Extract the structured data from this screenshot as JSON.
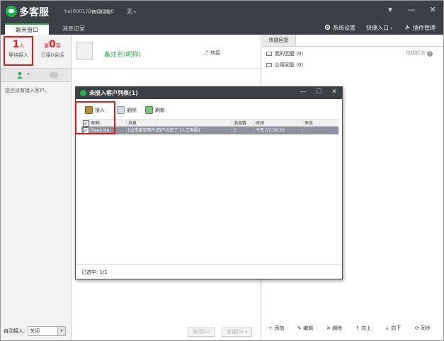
{
  "titlebar": {
    "app_title": "多客服",
    "account": "hu[0001]@webusc0",
    "status": "自动回复",
    "status_value": "无",
    "controls": [
      "▾",
      "—",
      "✕"
    ]
  },
  "nav": {
    "tabs": [
      "聊天窗口",
      "消息记录"
    ],
    "active_tab": 0,
    "right": [
      "系统设置",
      "快捷入口",
      "插件管理"
    ]
  },
  "left": {
    "waiting": {
      "num": "1",
      "unit": "人",
      "label": "等待接入"
    },
    "sessions": {
      "num": "0",
      "unit": "客",
      "label": "已接0会话",
      "prefix": "第"
    },
    "empty_text": "您还没有接入客户。",
    "auto_accept_label": "自动接入:",
    "auto_accept_value": "关闭"
  },
  "middle": {
    "remark_name": "备注名(昵称)",
    "transfer": "转接",
    "close_btn": "关闭(C)",
    "send_btn": "发送(S)"
  },
  "right": {
    "tab": "快捷回复",
    "tip": "快捷标志",
    "folders": [
      "我的回复 (0)",
      "公用回复 (0)"
    ],
    "actions": [
      "添加",
      "编辑",
      "删除",
      "向上",
      "向下",
      "同步"
    ]
  },
  "dialog": {
    "title": "未接入客户列表(1)",
    "toolbar": [
      "接入",
      "删除",
      "刷新"
    ],
    "columns": [
      "昵称",
      "消息",
      "消息数",
      "时间",
      "来自"
    ],
    "rows": [
      {
        "nickname": "Raen Hu",
        "message": "[点击菜单事件]用户点击了 [人工客服]",
        "count": "1",
        "time": "今天 07:58:33",
        "from": ""
      }
    ],
    "selected": "已选中: 1/1"
  },
  "colors": {
    "accent_green": "#23b14d",
    "title_bar": "#3b3e44",
    "highlight_red": "#e01818",
    "selected_row": "#8c929e"
  }
}
